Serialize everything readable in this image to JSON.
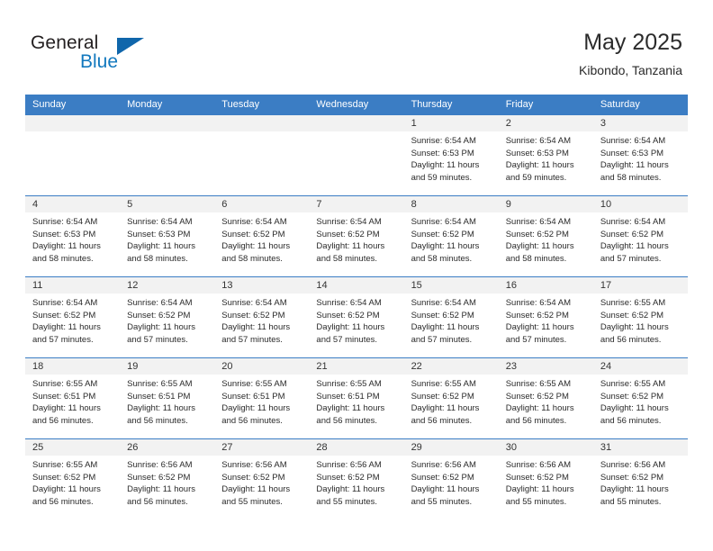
{
  "brand": {
    "name_part1": "General",
    "name_part2": "Blue",
    "triangle_color": "#1066ab",
    "blue_color": "#1278be"
  },
  "header": {
    "title": "May 2025",
    "subtitle": "Kibondo, Tanzania"
  },
  "theme": {
    "header_row_bg": "#3b7dc4",
    "daynum_band_bg": "#f2f2f2",
    "cell_border": "#3b7dc4"
  },
  "weekdays": [
    "Sunday",
    "Monday",
    "Tuesday",
    "Wednesday",
    "Thursday",
    "Friday",
    "Saturday"
  ],
  "weeks": [
    [
      {
        "day": "",
        "sunrise": "",
        "sunset": "",
        "daylight_l1": "",
        "daylight_l2": "",
        "empty": true
      },
      {
        "day": "",
        "sunrise": "",
        "sunset": "",
        "daylight_l1": "",
        "daylight_l2": "",
        "empty": true
      },
      {
        "day": "",
        "sunrise": "",
        "sunset": "",
        "daylight_l1": "",
        "daylight_l2": "",
        "empty": true
      },
      {
        "day": "",
        "sunrise": "",
        "sunset": "",
        "daylight_l1": "",
        "daylight_l2": "",
        "empty": true
      },
      {
        "day": "1",
        "sunrise": "Sunrise: 6:54 AM",
        "sunset": "Sunset: 6:53 PM",
        "daylight_l1": "Daylight: 11 hours",
        "daylight_l2": "and 59 minutes.",
        "empty": false
      },
      {
        "day": "2",
        "sunrise": "Sunrise: 6:54 AM",
        "sunset": "Sunset: 6:53 PM",
        "daylight_l1": "Daylight: 11 hours",
        "daylight_l2": "and 59 minutes.",
        "empty": false
      },
      {
        "day": "3",
        "sunrise": "Sunrise: 6:54 AM",
        "sunset": "Sunset: 6:53 PM",
        "daylight_l1": "Daylight: 11 hours",
        "daylight_l2": "and 58 minutes.",
        "empty": false
      }
    ],
    [
      {
        "day": "4",
        "sunrise": "Sunrise: 6:54 AM",
        "sunset": "Sunset: 6:53 PM",
        "daylight_l1": "Daylight: 11 hours",
        "daylight_l2": "and 58 minutes.",
        "empty": false
      },
      {
        "day": "5",
        "sunrise": "Sunrise: 6:54 AM",
        "sunset": "Sunset: 6:53 PM",
        "daylight_l1": "Daylight: 11 hours",
        "daylight_l2": "and 58 minutes.",
        "empty": false
      },
      {
        "day": "6",
        "sunrise": "Sunrise: 6:54 AM",
        "sunset": "Sunset: 6:52 PM",
        "daylight_l1": "Daylight: 11 hours",
        "daylight_l2": "and 58 minutes.",
        "empty": false
      },
      {
        "day": "7",
        "sunrise": "Sunrise: 6:54 AM",
        "sunset": "Sunset: 6:52 PM",
        "daylight_l1": "Daylight: 11 hours",
        "daylight_l2": "and 58 minutes.",
        "empty": false
      },
      {
        "day": "8",
        "sunrise": "Sunrise: 6:54 AM",
        "sunset": "Sunset: 6:52 PM",
        "daylight_l1": "Daylight: 11 hours",
        "daylight_l2": "and 58 minutes.",
        "empty": false
      },
      {
        "day": "9",
        "sunrise": "Sunrise: 6:54 AM",
        "sunset": "Sunset: 6:52 PM",
        "daylight_l1": "Daylight: 11 hours",
        "daylight_l2": "and 58 minutes.",
        "empty": false
      },
      {
        "day": "10",
        "sunrise": "Sunrise: 6:54 AM",
        "sunset": "Sunset: 6:52 PM",
        "daylight_l1": "Daylight: 11 hours",
        "daylight_l2": "and 57 minutes.",
        "empty": false
      }
    ],
    [
      {
        "day": "11",
        "sunrise": "Sunrise: 6:54 AM",
        "sunset": "Sunset: 6:52 PM",
        "daylight_l1": "Daylight: 11 hours",
        "daylight_l2": "and 57 minutes.",
        "empty": false
      },
      {
        "day": "12",
        "sunrise": "Sunrise: 6:54 AM",
        "sunset": "Sunset: 6:52 PM",
        "daylight_l1": "Daylight: 11 hours",
        "daylight_l2": "and 57 minutes.",
        "empty": false
      },
      {
        "day": "13",
        "sunrise": "Sunrise: 6:54 AM",
        "sunset": "Sunset: 6:52 PM",
        "daylight_l1": "Daylight: 11 hours",
        "daylight_l2": "and 57 minutes.",
        "empty": false
      },
      {
        "day": "14",
        "sunrise": "Sunrise: 6:54 AM",
        "sunset": "Sunset: 6:52 PM",
        "daylight_l1": "Daylight: 11 hours",
        "daylight_l2": "and 57 minutes.",
        "empty": false
      },
      {
        "day": "15",
        "sunrise": "Sunrise: 6:54 AM",
        "sunset": "Sunset: 6:52 PM",
        "daylight_l1": "Daylight: 11 hours",
        "daylight_l2": "and 57 minutes.",
        "empty": false
      },
      {
        "day": "16",
        "sunrise": "Sunrise: 6:54 AM",
        "sunset": "Sunset: 6:52 PM",
        "daylight_l1": "Daylight: 11 hours",
        "daylight_l2": "and 57 minutes.",
        "empty": false
      },
      {
        "day": "17",
        "sunrise": "Sunrise: 6:55 AM",
        "sunset": "Sunset: 6:52 PM",
        "daylight_l1": "Daylight: 11 hours",
        "daylight_l2": "and 56 minutes.",
        "empty": false
      }
    ],
    [
      {
        "day": "18",
        "sunrise": "Sunrise: 6:55 AM",
        "sunset": "Sunset: 6:51 PM",
        "daylight_l1": "Daylight: 11 hours",
        "daylight_l2": "and 56 minutes.",
        "empty": false
      },
      {
        "day": "19",
        "sunrise": "Sunrise: 6:55 AM",
        "sunset": "Sunset: 6:51 PM",
        "daylight_l1": "Daylight: 11 hours",
        "daylight_l2": "and 56 minutes.",
        "empty": false
      },
      {
        "day": "20",
        "sunrise": "Sunrise: 6:55 AM",
        "sunset": "Sunset: 6:51 PM",
        "daylight_l1": "Daylight: 11 hours",
        "daylight_l2": "and 56 minutes.",
        "empty": false
      },
      {
        "day": "21",
        "sunrise": "Sunrise: 6:55 AM",
        "sunset": "Sunset: 6:51 PM",
        "daylight_l1": "Daylight: 11 hours",
        "daylight_l2": "and 56 minutes.",
        "empty": false
      },
      {
        "day": "22",
        "sunrise": "Sunrise: 6:55 AM",
        "sunset": "Sunset: 6:52 PM",
        "daylight_l1": "Daylight: 11 hours",
        "daylight_l2": "and 56 minutes.",
        "empty": false
      },
      {
        "day": "23",
        "sunrise": "Sunrise: 6:55 AM",
        "sunset": "Sunset: 6:52 PM",
        "daylight_l1": "Daylight: 11 hours",
        "daylight_l2": "and 56 minutes.",
        "empty": false
      },
      {
        "day": "24",
        "sunrise": "Sunrise: 6:55 AM",
        "sunset": "Sunset: 6:52 PM",
        "daylight_l1": "Daylight: 11 hours",
        "daylight_l2": "and 56 minutes.",
        "empty": false
      }
    ],
    [
      {
        "day": "25",
        "sunrise": "Sunrise: 6:55 AM",
        "sunset": "Sunset: 6:52 PM",
        "daylight_l1": "Daylight: 11 hours",
        "daylight_l2": "and 56 minutes.",
        "empty": false
      },
      {
        "day": "26",
        "sunrise": "Sunrise: 6:56 AM",
        "sunset": "Sunset: 6:52 PM",
        "daylight_l1": "Daylight: 11 hours",
        "daylight_l2": "and 56 minutes.",
        "empty": false
      },
      {
        "day": "27",
        "sunrise": "Sunrise: 6:56 AM",
        "sunset": "Sunset: 6:52 PM",
        "daylight_l1": "Daylight: 11 hours",
        "daylight_l2": "and 55 minutes.",
        "empty": false
      },
      {
        "day": "28",
        "sunrise": "Sunrise: 6:56 AM",
        "sunset": "Sunset: 6:52 PM",
        "daylight_l1": "Daylight: 11 hours",
        "daylight_l2": "and 55 minutes.",
        "empty": false
      },
      {
        "day": "29",
        "sunrise": "Sunrise: 6:56 AM",
        "sunset": "Sunset: 6:52 PM",
        "daylight_l1": "Daylight: 11 hours",
        "daylight_l2": "and 55 minutes.",
        "empty": false
      },
      {
        "day": "30",
        "sunrise": "Sunrise: 6:56 AM",
        "sunset": "Sunset: 6:52 PM",
        "daylight_l1": "Daylight: 11 hours",
        "daylight_l2": "and 55 minutes.",
        "empty": false
      },
      {
        "day": "31",
        "sunrise": "Sunrise: 6:56 AM",
        "sunset": "Sunset: 6:52 PM",
        "daylight_l1": "Daylight: 11 hours",
        "daylight_l2": "and 55 minutes.",
        "empty": false
      }
    ]
  ]
}
